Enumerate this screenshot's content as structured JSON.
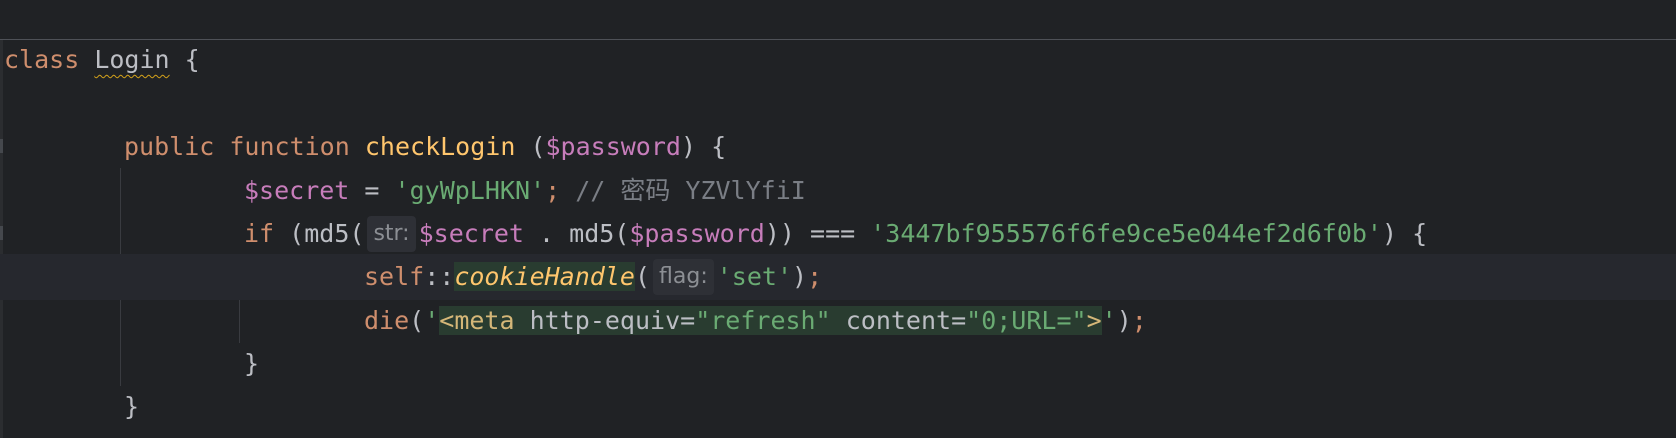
{
  "code": {
    "line1": {
      "kw": "class",
      "name": "Login",
      "brace": "{"
    },
    "line3": {
      "mod": "public",
      "kw": "function",
      "name": "checkLogin",
      "open": "(",
      "param": "$password",
      "close": ")",
      "brace": "{"
    },
    "line4": {
      "var": "$secret",
      "eq": "=",
      "val": "'gyWpLHKN'",
      "semi": ";",
      "comment": "// 密码 YZVlYfiI"
    },
    "line5": {
      "kw": "if",
      "open": "(md5(",
      "hint": "str:",
      "var": "$secret",
      "dot": ".",
      "md5": "md5(",
      "param": "$password",
      "close": "))",
      "op": "===",
      "hash": "'3447bf955576f6fe9ce5e044ef2d6f0b'",
      "end": ")",
      "brace": "{"
    },
    "line6": {
      "self": "self",
      "sep": "::",
      "method": "cookieHandle",
      "open": "(",
      "hint": "flag:",
      "arg": "'set'",
      "close": ")",
      "semi": ";"
    },
    "line7": {
      "fn": "die",
      "open": "(",
      "q1": "'",
      "tag_open": "<meta",
      "attr1": "http-equiv",
      "eq1": "=",
      "val1": "\"refresh\"",
      "attr2": "content",
      "eq2": "=",
      "val2": "\"0;URL=\"",
      "tag_close": ">",
      "q2": "'",
      "close": ")",
      "semi": ";"
    },
    "line8": {
      "brace": "}"
    },
    "line9": {
      "brace": "}"
    }
  },
  "colors": {
    "background": "#202225",
    "keyword": "#cf8e6d",
    "variable": "#c77dbb",
    "string": "#6aab73",
    "function": "#ffc66d",
    "comment": "#7a7e85",
    "injection": "#293c30"
  }
}
